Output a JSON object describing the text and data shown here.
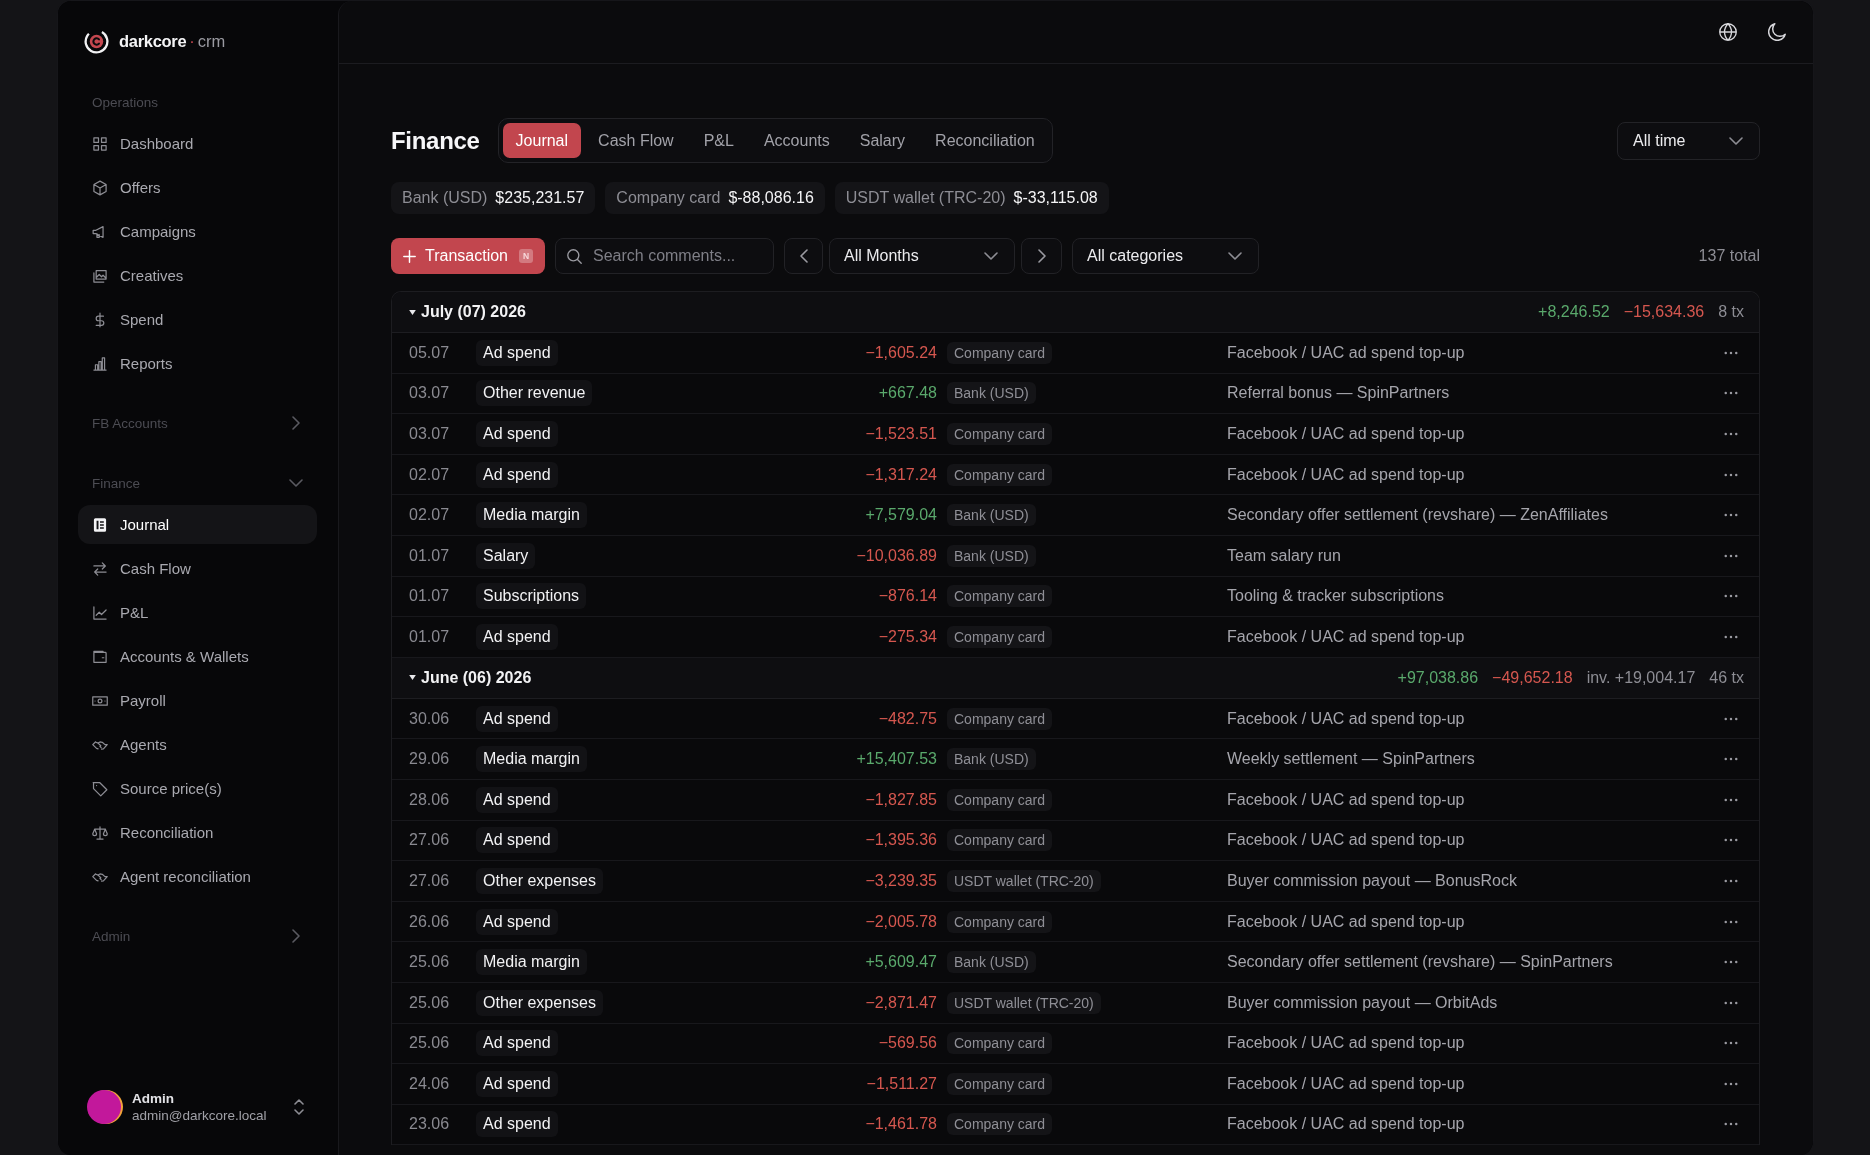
{
  "sidebar": {
    "brand": {
      "name": "darkcore",
      "separator": "·",
      "product": "crm"
    },
    "groups": [
      {
        "title": "Operations",
        "kind": "static",
        "items": [
          {
            "label": "Dashboard",
            "selected": false
          },
          {
            "label": "Offers",
            "selected": false
          },
          {
            "label": "Campaigns",
            "selected": false
          },
          {
            "label": "Creatives",
            "selected": false
          },
          {
            "label": "Spend",
            "selected": false
          },
          {
            "label": "Reports",
            "selected": false
          }
        ]
      },
      {
        "title": "FB Accounts",
        "kind": "collapsible",
        "expanded": false
      },
      {
        "title": "Finance",
        "kind": "collapsible",
        "expanded": true,
        "items": [
          {
            "label": "Journal",
            "selected": true
          },
          {
            "label": "Cash Flow",
            "selected": false
          },
          {
            "label": "P&L",
            "selected": false
          },
          {
            "label": "Accounts & Wallets",
            "selected": false
          },
          {
            "label": "Payroll",
            "selected": false
          },
          {
            "label": "Agents",
            "selected": false
          },
          {
            "label": "Source price(s)",
            "selected": false
          },
          {
            "label": "Reconciliation",
            "selected": false
          },
          {
            "label": "Agent reconciliation",
            "selected": false
          }
        ]
      },
      {
        "title": "Admin",
        "kind": "collapsible",
        "expanded": false
      }
    ],
    "user": {
      "name": "Admin",
      "email": "admin@darkcore.local"
    }
  },
  "page": {
    "title": "Finance",
    "tabs": [
      {
        "label": "Journal",
        "selected": true
      },
      {
        "label": "Cash Flow",
        "selected": false
      },
      {
        "label": "P&L",
        "selected": false
      },
      {
        "label": "Accounts",
        "selected": false
      },
      {
        "label": "Salary",
        "selected": false
      },
      {
        "label": "Reconciliation",
        "selected": false
      }
    ],
    "period_select": {
      "value": "All time"
    },
    "balances": [
      {
        "label": "Bank (USD)",
        "value": "$235,231.57"
      },
      {
        "label": "Company card",
        "value": "$-88,086.16"
      },
      {
        "label": "USDT wallet (TRC-20)",
        "value": "$-33,115.08"
      }
    ]
  },
  "toolbar": {
    "add_button": {
      "label": "Transaction",
      "shortcut": "N"
    },
    "search": {
      "placeholder": "Search comments..."
    },
    "month_select": {
      "value": "All Months"
    },
    "category_select": {
      "value": "All categories"
    },
    "total": "137 total"
  },
  "journal": {
    "groups": [
      {
        "title": "July (07) 2026",
        "expanded": true,
        "summary": [
          {
            "kind": "income",
            "text": "+8,246.52"
          },
          {
            "kind": "expense",
            "text": "−15,634.36"
          },
          {
            "kind": "count",
            "text": "8 tx"
          }
        ],
        "rows": [
          {
            "date": "05.07",
            "category": "Ad spend",
            "amount": "−1,605.24",
            "kind": "expense",
            "account": "Company card",
            "comment": "Facebook / UAC ad spend top-up"
          },
          {
            "date": "03.07",
            "category": "Other revenue",
            "amount": "+667.48",
            "kind": "income",
            "account": "Bank (USD)",
            "comment": "Referral bonus — SpinPartners"
          },
          {
            "date": "03.07",
            "category": "Ad spend",
            "amount": "−1,523.51",
            "kind": "expense",
            "account": "Company card",
            "comment": "Facebook / UAC ad spend top-up"
          },
          {
            "date": "02.07",
            "category": "Ad spend",
            "amount": "−1,317.24",
            "kind": "expense",
            "account": "Company card",
            "comment": "Facebook / UAC ad spend top-up"
          },
          {
            "date": "02.07",
            "category": "Media margin",
            "amount": "+7,579.04",
            "kind": "income",
            "account": "Bank (USD)",
            "comment": "Secondary offer settlement (revshare) — ZenAffiliates"
          },
          {
            "date": "01.07",
            "category": "Salary",
            "amount": "−10,036.89",
            "kind": "expense",
            "account": "Bank (USD)",
            "comment": "Team salary run"
          },
          {
            "date": "01.07",
            "category": "Subscriptions",
            "amount": "−876.14",
            "kind": "expense",
            "account": "Company card",
            "comment": "Tooling & tracker subscriptions"
          },
          {
            "date": "01.07",
            "category": "Ad spend",
            "amount": "−275.34",
            "kind": "expense",
            "account": "Company card",
            "comment": "Facebook / UAC ad spend top-up"
          }
        ]
      },
      {
        "title": "June (06) 2026",
        "expanded": true,
        "summary": [
          {
            "kind": "income",
            "text": "+97,038.86"
          },
          {
            "kind": "expense",
            "text": "−49,652.18"
          },
          {
            "kind": "note",
            "text": "inv. +19,004.17"
          },
          {
            "kind": "count",
            "text": "46 tx"
          }
        ],
        "rows": [
          {
            "date": "30.06",
            "category": "Ad spend",
            "amount": "−482.75",
            "kind": "expense",
            "account": "Company card",
            "comment": "Facebook / UAC ad spend top-up"
          },
          {
            "date": "29.06",
            "category": "Media margin",
            "amount": "+15,407.53",
            "kind": "income",
            "account": "Bank (USD)",
            "comment": "Weekly settlement — SpinPartners"
          },
          {
            "date": "28.06",
            "category": "Ad spend",
            "amount": "−1,827.85",
            "kind": "expense",
            "account": "Company card",
            "comment": "Facebook / UAC ad spend top-up"
          },
          {
            "date": "27.06",
            "category": "Ad spend",
            "amount": "−1,395.36",
            "kind": "expense",
            "account": "Company card",
            "comment": "Facebook / UAC ad spend top-up"
          },
          {
            "date": "27.06",
            "category": "Other expenses",
            "amount": "−3,239.35",
            "kind": "expense",
            "account": "USDT wallet (TRC-20)",
            "comment": "Buyer commission payout — BonusRock"
          },
          {
            "date": "26.06",
            "category": "Ad spend",
            "amount": "−2,005.78",
            "kind": "expense",
            "account": "Company card",
            "comment": "Facebook / UAC ad spend top-up"
          },
          {
            "date": "25.06",
            "category": "Media margin",
            "amount": "+5,609.47",
            "kind": "income",
            "account": "Bank (USD)",
            "comment": "Secondary offer settlement (revshare) — SpinPartners"
          },
          {
            "date": "25.06",
            "category": "Other expenses",
            "amount": "−2,871.47",
            "kind": "expense",
            "account": "USDT wallet (TRC-20)",
            "comment": "Buyer commission payout — OrbitAds"
          },
          {
            "date": "25.06",
            "category": "Ad spend",
            "amount": "−569.56",
            "kind": "expense",
            "account": "Company card",
            "comment": "Facebook / UAC ad spend top-up"
          },
          {
            "date": "24.06",
            "category": "Ad spend",
            "amount": "−1,511.27",
            "kind": "expense",
            "account": "Company card",
            "comment": "Facebook / UAC ad spend top-up"
          },
          {
            "date": "23.06",
            "category": "Ad spend",
            "amount": "−1,461.78",
            "kind": "expense",
            "account": "Company card",
            "comment": "Facebook / UAC ad spend top-up"
          }
        ]
      }
    ]
  }
}
